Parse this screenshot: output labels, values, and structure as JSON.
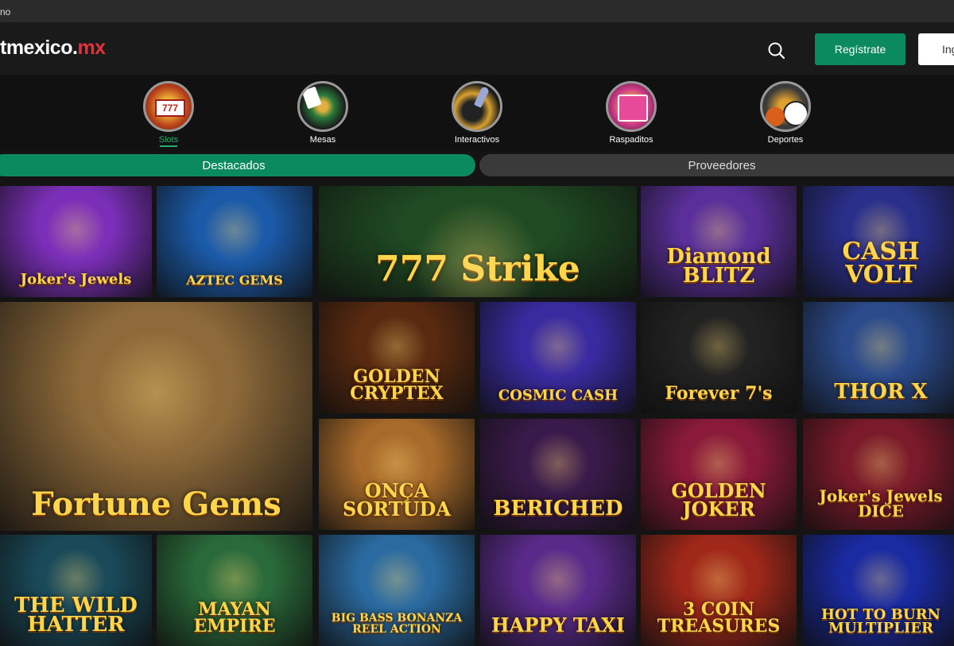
{
  "browser": {
    "tab_fragment": "no"
  },
  "header": {
    "logo": {
      "prefix": "t",
      "name": "mexico",
      "dot": ".",
      "tld": "mx"
    },
    "register_label": "Regístrate",
    "login_label": "Ing"
  },
  "categories": [
    {
      "label": "Slots",
      "icon": "slot-machine-icon",
      "active": true
    },
    {
      "label": "Mesas",
      "icon": "roulette-cards-icon",
      "active": false
    },
    {
      "label": "Interactivos",
      "icon": "rocket-bomb-icon",
      "active": false
    },
    {
      "label": "Raspaditos",
      "icon": "scratch-card-icon",
      "active": false
    },
    {
      "label": "Deportes",
      "icon": "sports-balls-icon",
      "active": false
    }
  ],
  "tabs": {
    "featured": "Destacados",
    "providers": "Proveedores"
  },
  "games": [
    {
      "title": "Joker's Jewels",
      "color": "#7b2fb8"
    },
    {
      "title": "AZTEC GEMS",
      "color": "#1b5aa8"
    },
    {
      "title": "777 Strike",
      "color": "#1f4a22"
    },
    {
      "title": "Diamond BLITZ",
      "color": "#5a2f9a"
    },
    {
      "title": "CASH VOLT",
      "color": "#2a2f8a"
    },
    {
      "title": "Fortune Gems",
      "color": "#8e6a3a"
    },
    {
      "title": "GOLDEN CRYPTEX",
      "color": "#5a2a10"
    },
    {
      "title": "COSMIC CASH",
      "color": "#3a2aa0"
    },
    {
      "title": "Forever 7's",
      "color": "#222222"
    },
    {
      "title": "THOR X",
      "color": "#2a4a8a"
    },
    {
      "title": "ONÇA SORTUDA",
      "color": "#a86a2a"
    },
    {
      "title": "BERICHED",
      "color": "#3a1a4a"
    },
    {
      "title": "GOLDEN JOKER",
      "color": "#8a1a3a"
    },
    {
      "title": "Joker's Jewels DICE",
      "color": "#7a1a2a"
    },
    {
      "title": "THE WILD HATTER",
      "color": "#1a4a5a"
    },
    {
      "title": "MAYAN EMPIRE",
      "color": "#2a6a3a"
    },
    {
      "title": "BIG BASS BONANZA REEL ACTION",
      "color": "#2a6aa0"
    },
    {
      "title": "HAPPY TAXI",
      "color": "#5a2a8a"
    },
    {
      "title": "3 COIN TREASURES",
      "color": "#a0281a"
    },
    {
      "title": "HOT TO BURN MULTIPLIER",
      "color": "#1a2aa0"
    }
  ]
}
